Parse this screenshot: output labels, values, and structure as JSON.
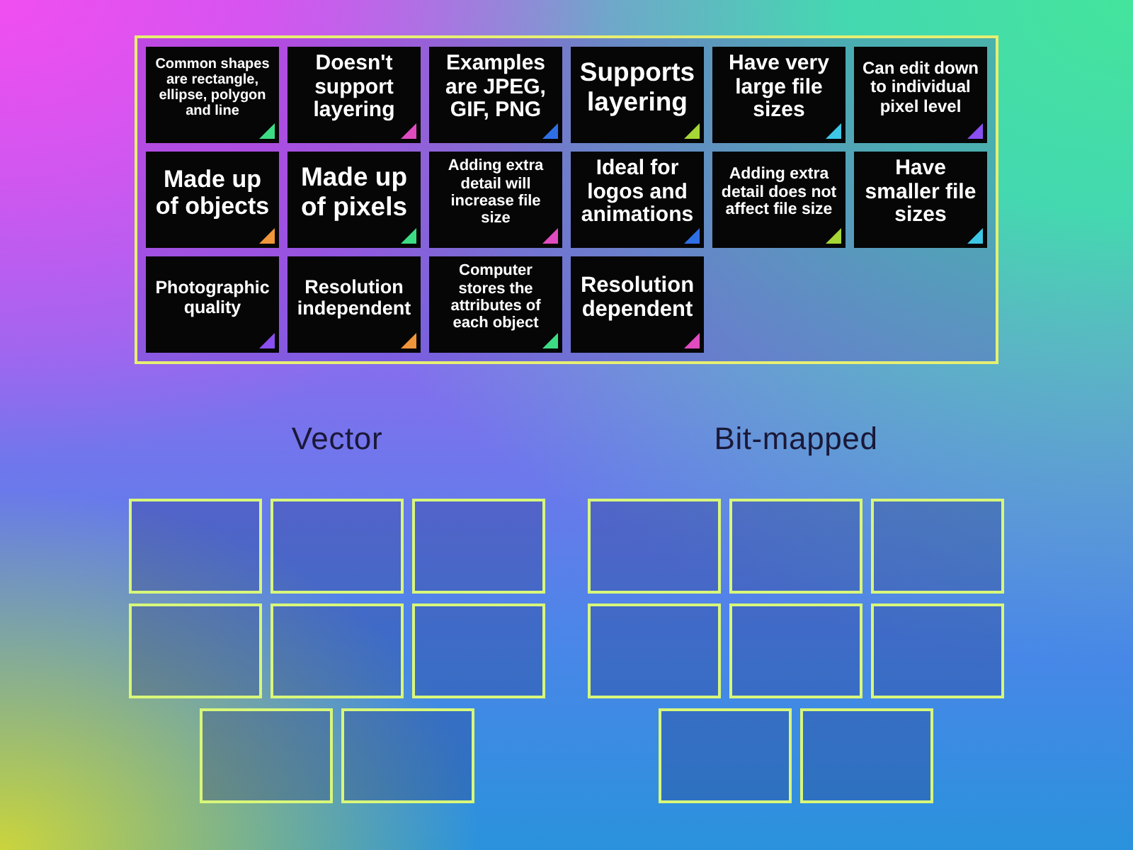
{
  "tray": {
    "cards": [
      {
        "text": "Common shapes are rectangle, ellipse, polygon and line",
        "color": "#3ddc84"
      },
      {
        "text": "Doesn't support layering",
        "color": "#e04bc0"
      },
      {
        "text": "Examples are JPEG, GIF, PNG",
        "color": "#2f6fe6"
      },
      {
        "text": "Supports layering",
        "color": "#a6d636"
      },
      {
        "text": "Have very large file sizes",
        "color": "#3ec6e6"
      },
      {
        "text": "Can edit down to individual pixel level",
        "color": "#8a4ff0"
      },
      {
        "text": "Made up of objects",
        "color": "#f0963a"
      },
      {
        "text": "Made up of pixels",
        "color": "#3ddc84"
      },
      {
        "text": "Adding extra detail will increase file size",
        "color": "#e04bc0"
      },
      {
        "text": "Ideal for logos and animations",
        "color": "#2f6fe6"
      },
      {
        "text": "Adding extra detail does not affect file size",
        "color": "#a6d636"
      },
      {
        "text": "Have smaller file sizes",
        "color": "#3ec6e6"
      },
      {
        "text": "Photographic quality",
        "color": "#8a4ff0"
      },
      {
        "text": "Resolution independent",
        "color": "#f0963a"
      },
      {
        "text": "Computer stores the attributes of each object",
        "color": "#3ddc84"
      },
      {
        "text": "Resolution dependent",
        "color": "#e04bc0"
      }
    ]
  },
  "groups": [
    {
      "title": "Vector"
    },
    {
      "title": "Bit-mapped"
    }
  ]
}
